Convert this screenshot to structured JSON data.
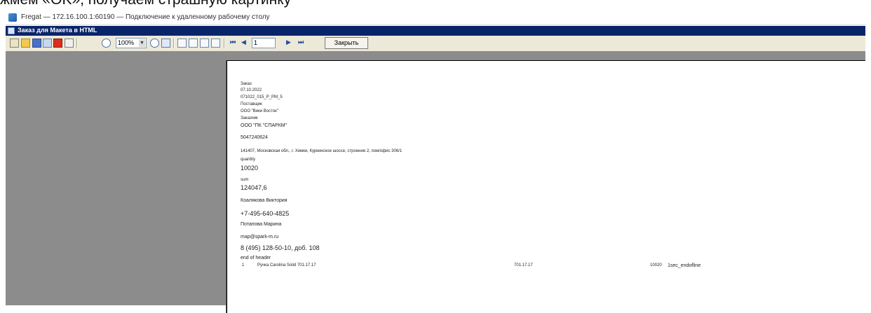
{
  "caption": "жмём «OK», получаем страшную картинку",
  "rdp_window": {
    "title": "Fregat — 172.16.100.1:60190 — Подключение к удаленному рабочему столу"
  },
  "app_window": {
    "title": "Заказ для Макета в HTML"
  },
  "toolbar": {
    "zoom_value": "100%",
    "page_value": "1",
    "close_label": "Закрыть",
    "nav_first": "⏮",
    "nav_prev": "◀",
    "nav_next": "▶",
    "nav_last": "⏭"
  },
  "report": {
    "header_lines": [
      "Заказ",
      "07.10.2022",
      "071022_015_P_PM_5",
      "Поставщик",
      "ООО \"Вики Восток\"",
      "Заказчик",
      "ООО \"ПК \"СПАРКМ\"",
      "5047240624",
      "141407, Московская обл., г. Химки, Куркинское шоссе, строение 2, пом/офис 306/1",
      "quantity",
      "10020",
      "sum",
      "124047,6",
      "Коалякова Виктория",
      "+7-495-640-4825",
      "Потапова Марина",
      "map@spark-m.ru",
      "8 (495) 128-50-10, доб. 108",
      "end of header"
    ],
    "line_item": {
      "num": "1",
      "name": "Ручка Carolina Solid 701.17.17",
      "article": "701.17.17",
      "qty": "10020",
      "tail": "1sec_endofline"
    }
  }
}
